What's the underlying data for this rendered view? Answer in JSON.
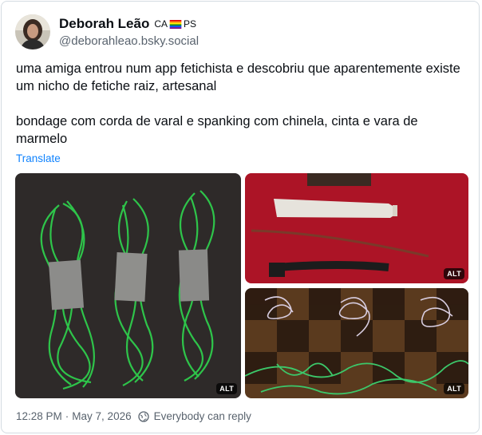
{
  "author": {
    "display_name": "Deborah Leão",
    "badge_prefix": "CA",
    "badge_suffix": "PS",
    "handle": "@deborahleao.bsky.social"
  },
  "post": {
    "paragraph_1": "uma amiga entrou num app fetichista e descobriu que aparentemente existe um nicho de fetiche raiz, artesanal",
    "paragraph_2": "bondage com corda de varal e spanking com chinela, cinta e vara de marmelo",
    "translate_label": "Translate"
  },
  "media": {
    "images": [
      {
        "alt_label": "ALT",
        "icon": "green-rope-photo"
      },
      {
        "alt_label": "ALT",
        "icon": "slipper-belt-stick-photo"
      },
      {
        "alt_label": "ALT",
        "icon": "cords-on-floor-photo"
      }
    ]
  },
  "footer": {
    "time": "12:28 PM",
    "separator": "·",
    "date": "May 7, 2026",
    "reply_setting": "Everybody can reply"
  },
  "colors": {
    "link": "#1083fe",
    "muted": "#59636e",
    "border": "#d4dbe2"
  }
}
